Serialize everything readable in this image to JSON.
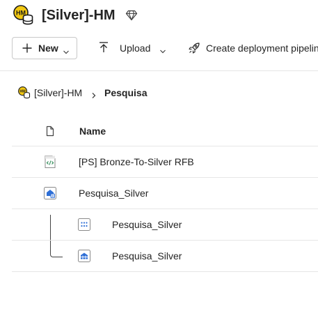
{
  "header": {
    "workspace_title": "[Silver]-HM",
    "workspace_logo_text": "HM",
    "workspace_logo_icon": "workspace-logo-icon",
    "premium_icon": "diamond-icon"
  },
  "toolbar": {
    "new_label": "New",
    "upload_label": "Upload",
    "deployment_label": "Create deployment pipelin"
  },
  "breadcrumb": {
    "workspace": "[Silver]-HM",
    "current": "Pesquisa"
  },
  "table": {
    "name_header": "Name",
    "rows": [
      {
        "name": "[PS] Bronze-To-Silver RFB",
        "icon": "notebook-icon"
      },
      {
        "name": "Pesquisa_Silver",
        "icon": "lakehouse-icon"
      },
      {
        "name": "Pesquisa_Silver",
        "icon": "sql-endpoint-icon",
        "child": true
      },
      {
        "name": "Pesquisa_Silver",
        "icon": "semantic-model-icon",
        "child": true
      }
    ]
  },
  "colors": {
    "accent_blue": "#2f6fd6",
    "logo_yellow": "#f2c811",
    "border": "#e6e6e6"
  }
}
